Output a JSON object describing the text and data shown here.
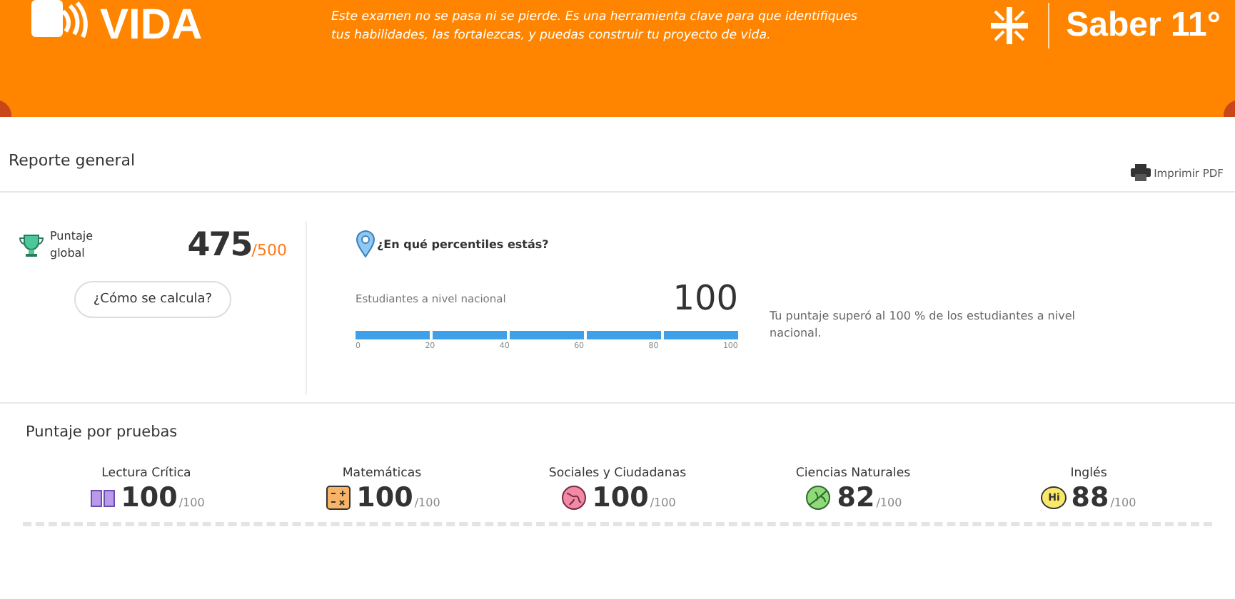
{
  "header": {
    "logo_text": "VIDA",
    "message": "Este examen no se pasa ni se pierde. Es una herramienta clave para que identifiques tus habilidades, las fortalezcas, y puedas construir tu proyecto de vida.",
    "brand": "Saber 11°"
  },
  "report": {
    "title": "Reporte general",
    "print_button": "Imprimir PDF"
  },
  "global_score": {
    "label": "Puntaje global",
    "score": "475",
    "max": "/500",
    "button": "¿Cómo se calcula?"
  },
  "percentile": {
    "title": "¿En qué percentiles estás?",
    "label": "Estudiantes a nivel nacional",
    "value": "100",
    "level": 1,
    "ticks": [
      "0",
      "20",
      "40",
      "60",
      "80",
      "100"
    ],
    "note": "Tu puntaje superó al 100 % de los estudiantes a nivel nacional."
  },
  "tests": {
    "title": "Puntaje por pruebas",
    "items": [
      {
        "name": "Lectura Crítica",
        "kind": "book",
        "score": "100",
        "max": "/100"
      },
      {
        "name": "Matemáticas",
        "kind": "calculator",
        "score": "100",
        "max": "/100"
      },
      {
        "name": "Sociales y Ciudadanas",
        "kind": "globe",
        "score": "100",
        "max": "/100"
      },
      {
        "name": "Ciencias Naturales",
        "kind": "leaf",
        "score": "82",
        "max": "/100"
      },
      {
        "name": "Inglés",
        "kind": "bubble",
        "icon_text": "Hi",
        "score": "88",
        "max": "/100"
      }
    ]
  }
}
